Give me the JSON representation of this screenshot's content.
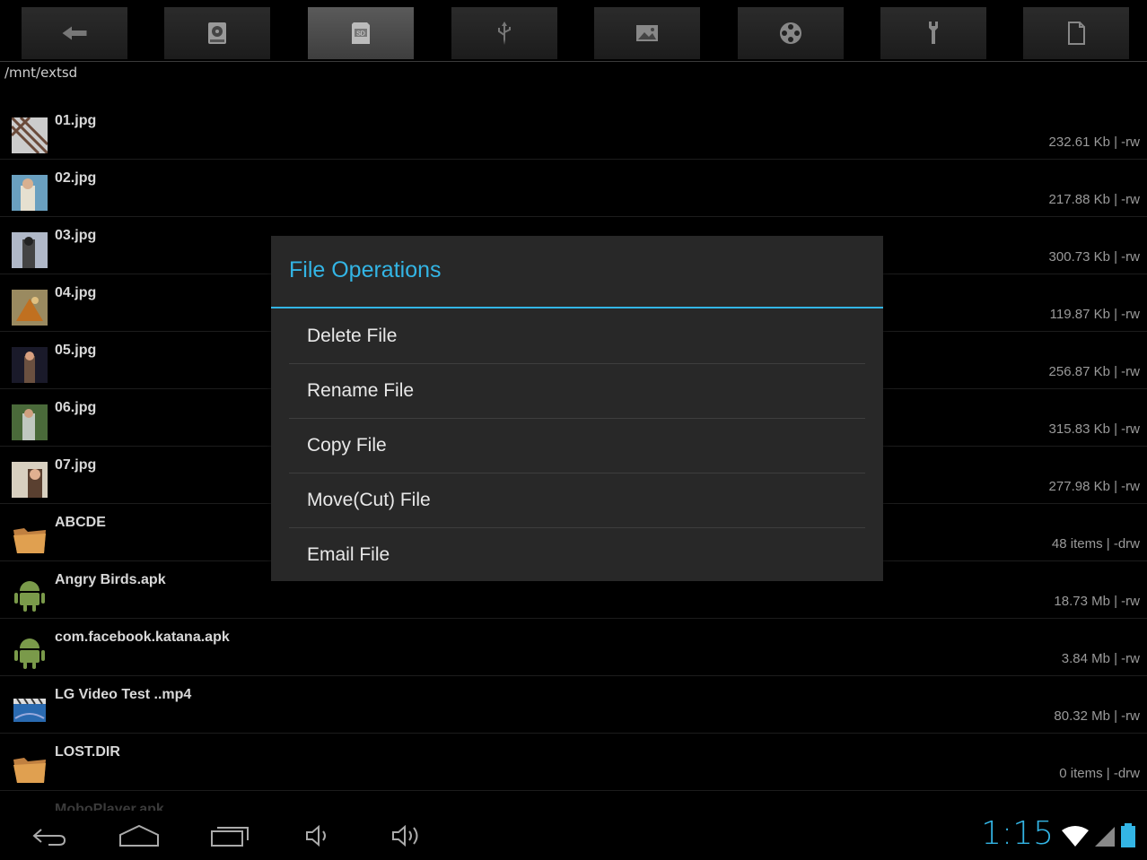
{
  "toolbar": {
    "buttons": [
      {
        "name": "back-arrow-icon"
      },
      {
        "name": "hard-drive-icon"
      },
      {
        "name": "sd-card-icon",
        "label": "SD"
      },
      {
        "name": "usb-icon"
      },
      {
        "name": "image-icon"
      },
      {
        "name": "film-reel-icon"
      },
      {
        "name": "wrench-icon"
      },
      {
        "name": "document-icon"
      }
    ]
  },
  "path": "/mnt/extsd",
  "files": [
    {
      "name": "01.jpg",
      "info": "232.61 Kb  | -rw",
      "type": "image"
    },
    {
      "name": "02.jpg",
      "info": "217.88 Kb  | -rw",
      "type": "image"
    },
    {
      "name": "03.jpg",
      "info": "300.73 Kb  | -rw",
      "type": "image"
    },
    {
      "name": "04.jpg",
      "info": "119.87 Kb  | -rw",
      "type": "image"
    },
    {
      "name": "05.jpg",
      "info": "256.87 Kb  | -rw",
      "type": "image"
    },
    {
      "name": "06.jpg",
      "info": "315.83 Kb  | -rw",
      "type": "image"
    },
    {
      "name": "07.jpg",
      "info": "277.98 Kb  | -rw",
      "type": "image"
    },
    {
      "name": "ABCDE",
      "info": "48 items | -drw",
      "type": "folder"
    },
    {
      "name": "Angry Birds.apk",
      "info": "18.73 Mb  | -rw",
      "type": "apk"
    },
    {
      "name": "com.facebook.katana.apk",
      "info": "3.84 Mb  | -rw",
      "type": "apk"
    },
    {
      "name": "LG Video Test ..mp4",
      "info": "80.32 Mb  | -rw",
      "type": "video"
    },
    {
      "name": "LOST.DIR",
      "info": "0 items | -drw",
      "type": "folder"
    },
    {
      "name": "MoboPlayer.apk",
      "info": "",
      "type": "apk"
    }
  ],
  "dialog": {
    "title": "File Operations",
    "items": [
      "Delete File",
      "Rename File",
      "Copy File",
      "Move(Cut) File",
      "Email File"
    ]
  },
  "navbar": {
    "clock": "1:15"
  },
  "colors": {
    "accent": "#33b5e5",
    "background": "#000000",
    "dialog_bg": "#282828"
  }
}
